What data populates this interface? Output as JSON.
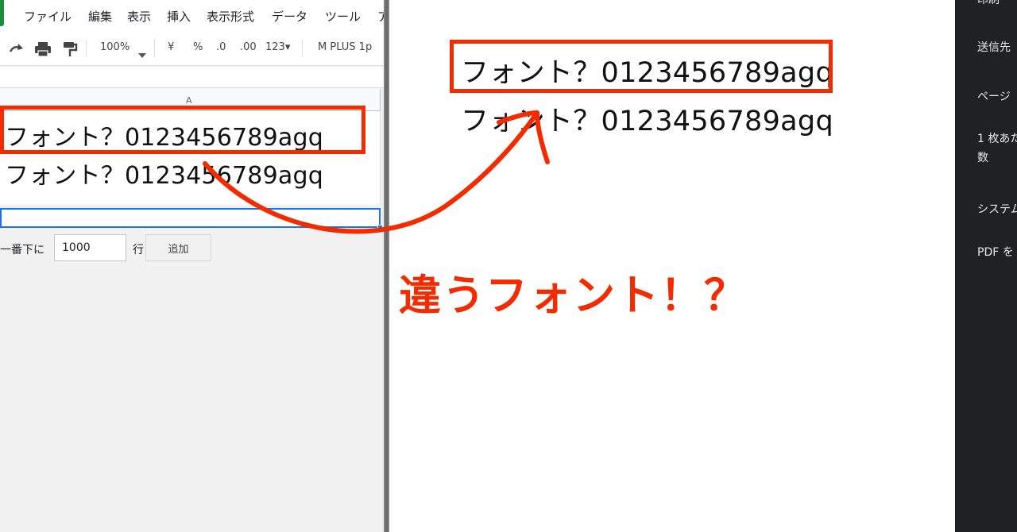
{
  "sheet": {
    "menu": [
      "ファイル",
      "編集",
      "表示",
      "挿入",
      "表示形式",
      "データ",
      "ツール",
      "ア"
    ],
    "toolbar": {
      "zoom": "100%",
      "currency": "¥",
      "percent": "%",
      "decimal_decrease": ".0",
      "decimal_increase": ".00",
      "number_format": "123▾",
      "font": "M PLUS 1p"
    },
    "column_header": "A",
    "cells": [
      "フォント？0123456789agq",
      "フォント？0123456789agq"
    ],
    "add_rows": {
      "prefix": "一番下に",
      "value": "1000",
      "suffix": "行",
      "button": "追加"
    }
  },
  "preview": {
    "lines": [
      "フォント？0123456789agq",
      "フォント？0123456789agq"
    ]
  },
  "print_panel": {
    "options": [
      "印刷",
      "送信先",
      "ページ",
      "1 枚あた",
      "数",
      "システム",
      "PDF を"
    ]
  },
  "annotation": {
    "caption": "違うフォント！？",
    "color": "#f22b00"
  }
}
